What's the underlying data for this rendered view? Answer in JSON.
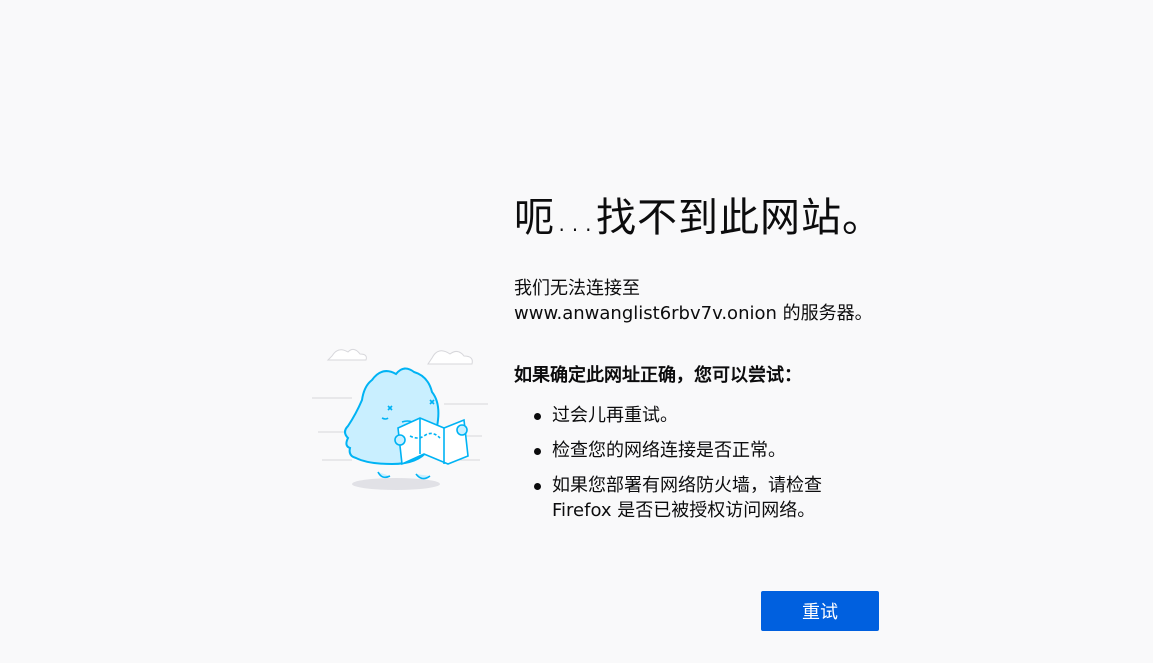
{
  "error": {
    "title": "呃…找不到此网站。",
    "description_line1": "我们无法连接至",
    "description_line2": "www.anwanglist6rbv7v.onion 的服务器。",
    "suggestions_title": "如果确定此网址正确，您可以尝试：",
    "suggestions": [
      "过会儿再重试。",
      "检查您的网络连接是否正常。",
      "如果您部署有网络防火墙，请检查",
      "Firefox 是否已被授权访问网络。"
    ]
  },
  "actions": {
    "retry_label": "重试"
  },
  "illustration": {
    "icon": "confused-monster-with-map-icon",
    "accent_color": "#00b3f4",
    "fill_color": "#c9efff"
  },
  "colors": {
    "background": "#f9f9fa",
    "button": "#0060df"
  }
}
